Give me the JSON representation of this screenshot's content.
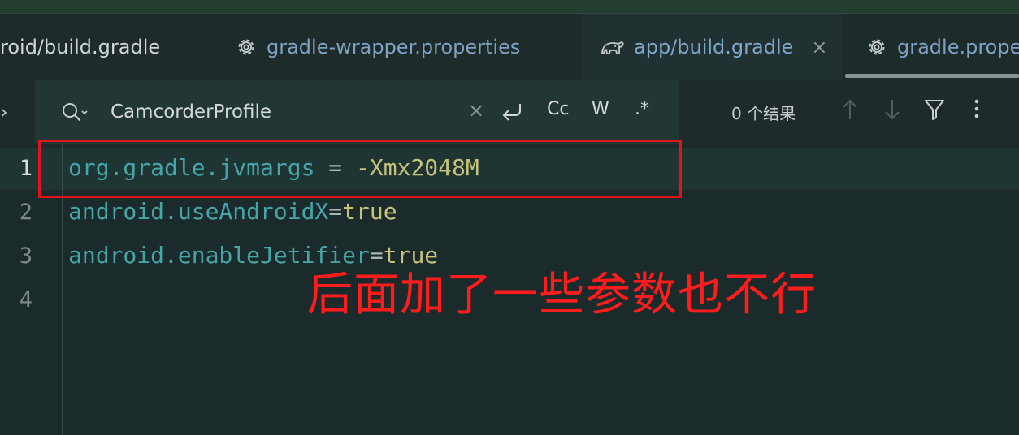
{
  "tabs": [
    {
      "label": "roid/build.gradle",
      "icon": "none",
      "active": false
    },
    {
      "label": "gradle-wrapper.properties",
      "icon": "gear-icon",
      "active": false
    },
    {
      "label": "app/build.gradle",
      "icon": "gradle-elephant-icon",
      "active": true,
      "close": "×"
    },
    {
      "label": "gradle.prope",
      "icon": "gear-icon",
      "active": false
    }
  ],
  "find": {
    "query": "CamcorderProfile",
    "clear": "×",
    "match_case": "Cc",
    "whole_word": "W",
    "regex": ".*",
    "results": "0 个结果"
  },
  "editor": {
    "line_numbers": [
      "1",
      "2",
      "3",
      "4"
    ],
    "lines": [
      {
        "key": "org.gradle.jvmargs",
        "op": " = ",
        "value": "-Xmx2048M"
      },
      {
        "key": "android.useAndroidX",
        "op": "=",
        "value": "true"
      },
      {
        "key": "android.enableJetifier",
        "op": "=",
        "value": "true"
      }
    ]
  },
  "annotation": "后面加了一些参数也不行",
  "colors": {
    "annotation": "#ff1c1c",
    "property_key": "#46a5a8",
    "property_value": "#c7c27a",
    "background": "#1b2a2a"
  }
}
